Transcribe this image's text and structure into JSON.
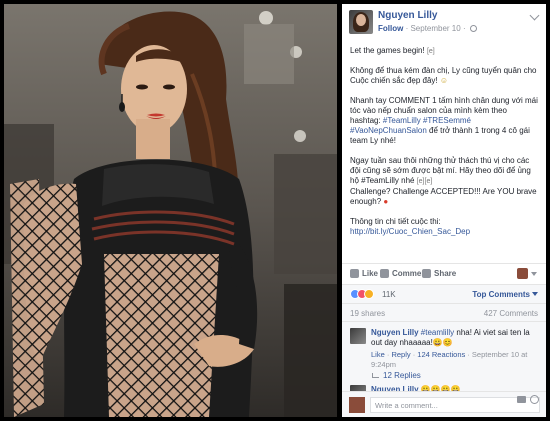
{
  "post": {
    "author": "Nguyen Lilly",
    "follow": "Follow",
    "date": "September 10",
    "globe_icon": "globe-icon",
    "paragraphs": {
      "p1": "Let the games begin!",
      "p1_emoji": "[e]",
      "p2": "Không để thua kém đàn chị, Ly cũng tuyển quân cho Cuộc chiến sắc đẹp đây!",
      "p2_emoji": "☺",
      "p3_a": "Nhanh tay COMMENT 1 tấm hình chân dung với mái tóc vào nếp chuẩn salon của mình kèm theo hashtag: ",
      "p3_tag1": "#TeamLilly",
      "p3_tag2": "#TRESemmé",
      "p3_tag3": "#VaoNepChuanSalon",
      "p3_b": " để trở thành 1 trong 4 cô gái team Ly nhé!",
      "p4_a": "Ngay tuần sau thôi những thử thách thú vị cho các đội cũng sẽ sớm được bật mí. Hãy theo dõi để ủng hộ #TeamLilly nhé",
      "p4_emoji": "[e][e]",
      "p4_b": "Challenge? Challenge ACCEPTED!!! Are YOU brave enough?",
      "p4_emoji2": "●",
      "p5_a": "Thông tin chi tiết cuộc thi:",
      "p5_link": "http://bit.ly/Cuoc_Chien_Sac_Dep"
    }
  },
  "actions": {
    "like": "Like",
    "comment": "Comment",
    "share": "Share"
  },
  "reactions": {
    "count": "11K",
    "top_comments": "Top Comments"
  },
  "stats": {
    "shares": "19 shares",
    "comments": "427 Comments"
  },
  "comment1": {
    "author": "Nguyen Lilly",
    "tag": "#teamlilly",
    "text": " nha! Ai viet sai ten la out day nhaaaaa!",
    "emojis": "😀😊",
    "like": "Like",
    "reply": "Reply",
    "reactions": "124 Reactions",
    "time": "September 10 at 9:24pm",
    "replies": "12 Replies"
  },
  "comment2": {
    "author": "Nguyen Lilly",
    "emojis": "😀😀😀😀"
  },
  "write": {
    "placeholder": "Write a comment..."
  },
  "colors": {
    "link": "#365899",
    "text": "#1d2129",
    "muted": "#90949c"
  }
}
